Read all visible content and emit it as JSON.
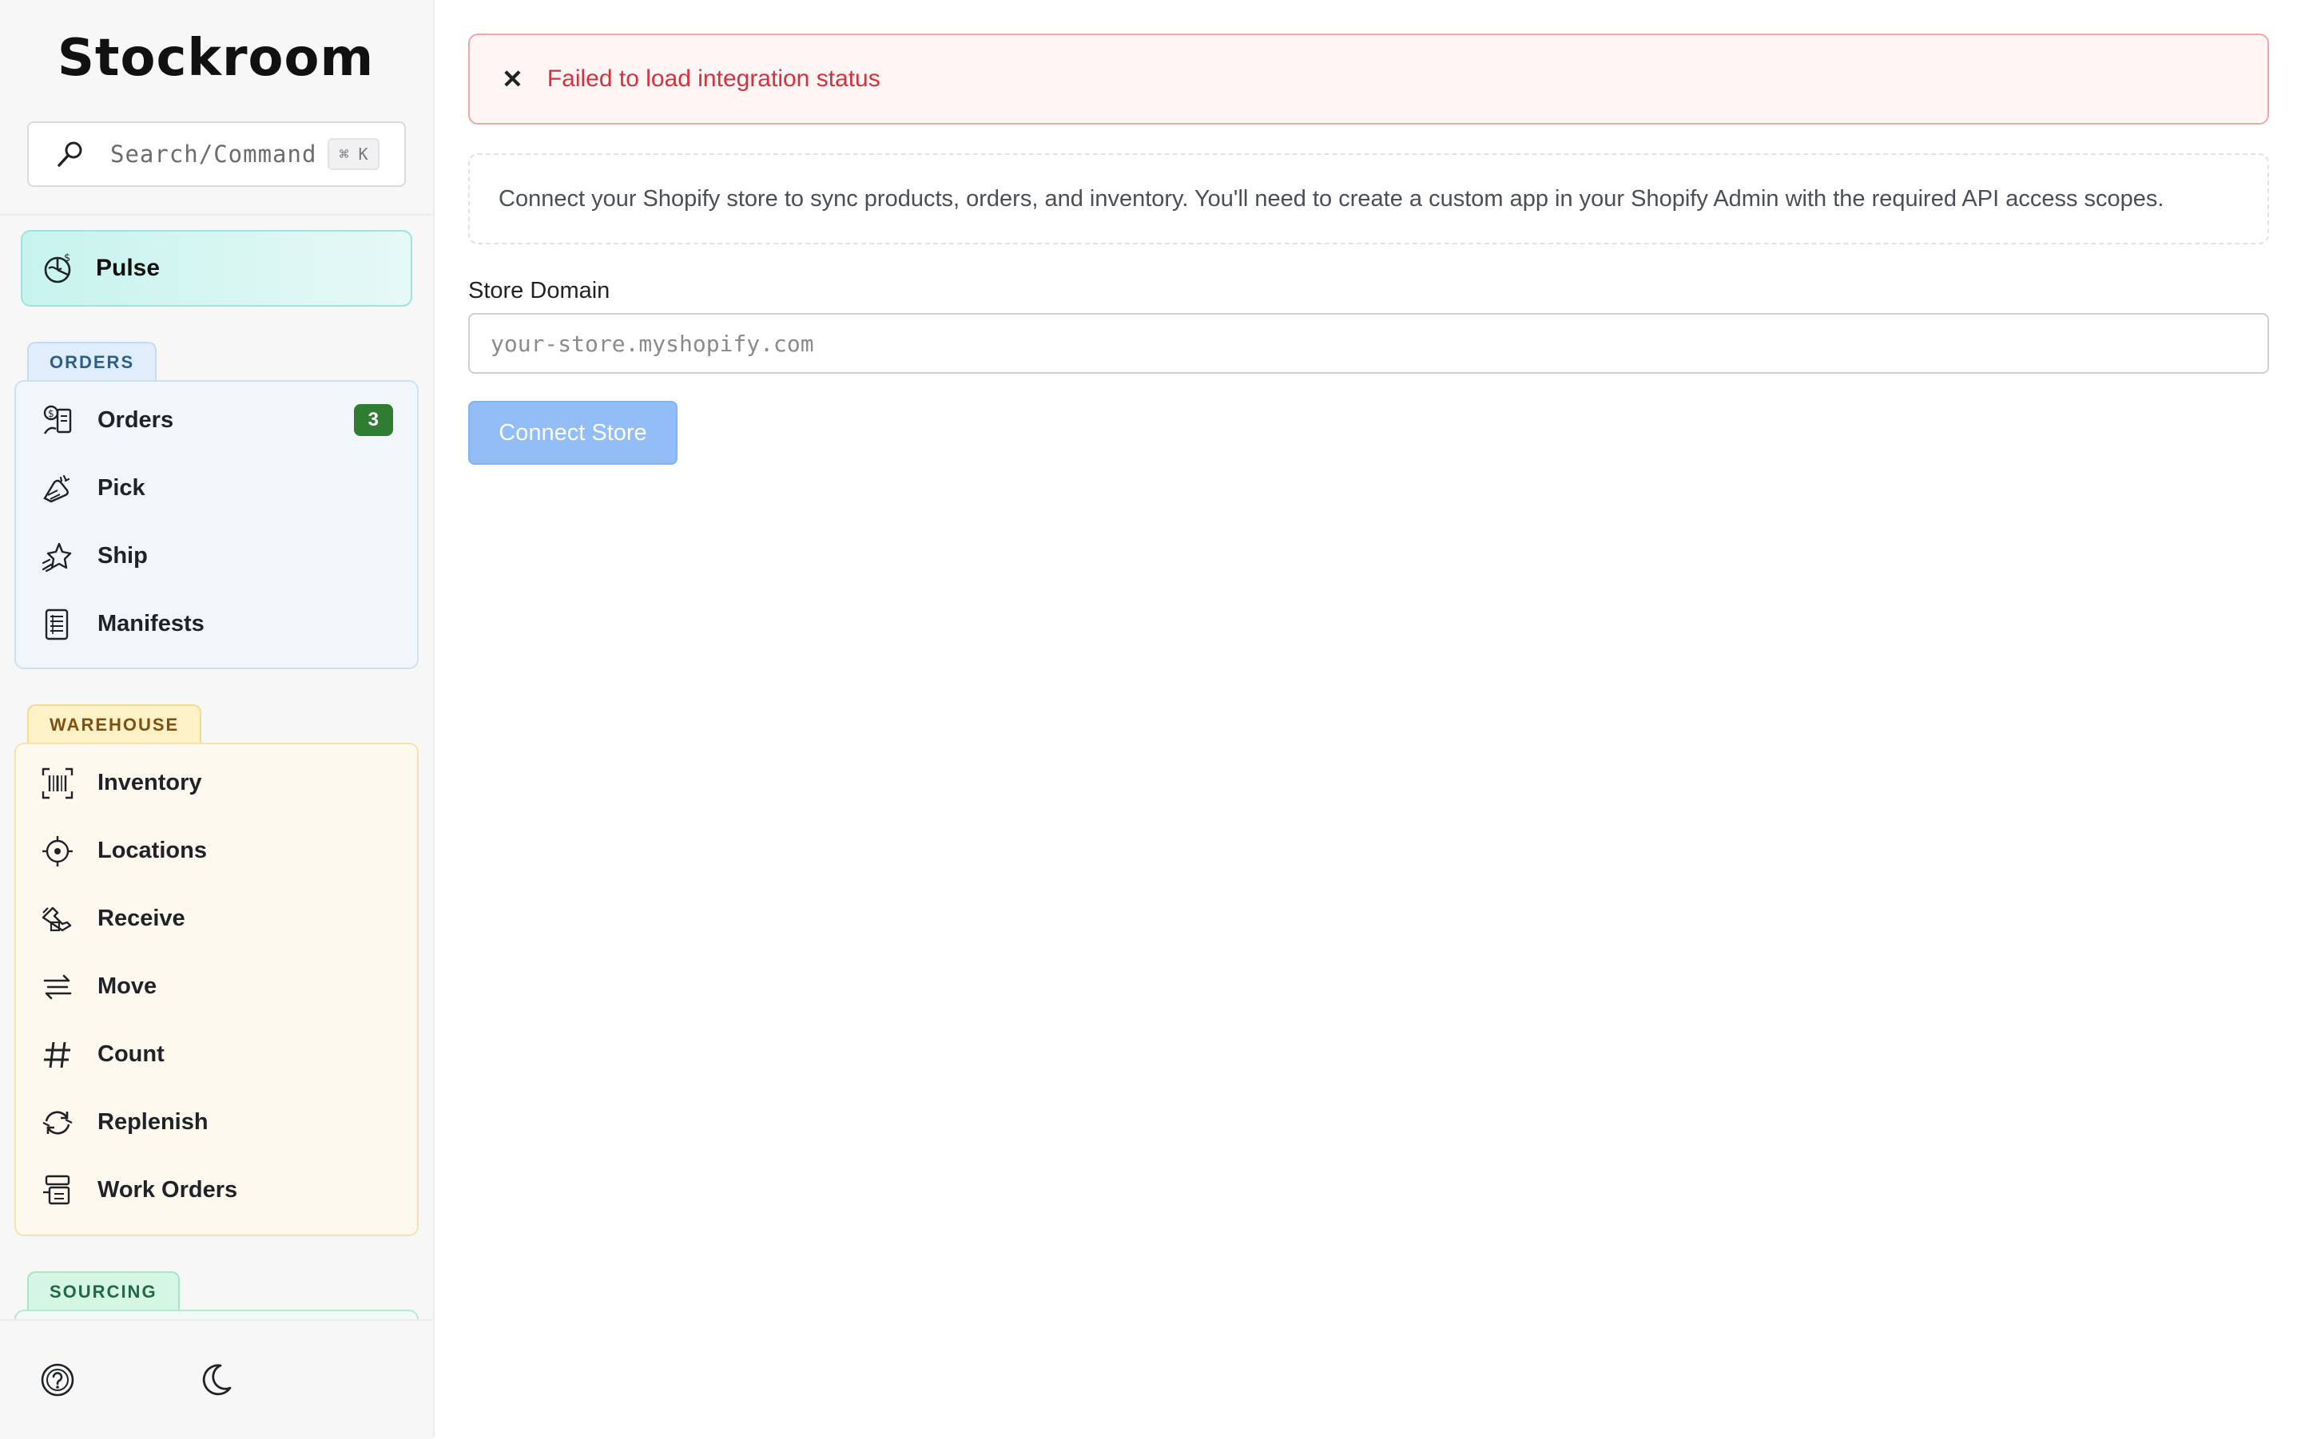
{
  "app": {
    "name": "Stockroom"
  },
  "search": {
    "placeholder": "Search/Command",
    "shortcut": "⌘ K"
  },
  "nav": {
    "pulse": {
      "label": "Pulse",
      "icon": "pulse-chart-icon"
    },
    "sections": [
      {
        "tag": "ORDERS",
        "items": [
          {
            "label": "Orders",
            "icon": "orders-icon",
            "badge": "3"
          },
          {
            "label": "Pick",
            "icon": "pick-icon"
          },
          {
            "label": "Ship",
            "icon": "ship-icon"
          },
          {
            "label": "Manifests",
            "icon": "manifest-icon"
          }
        ]
      },
      {
        "tag": "WAREHOUSE",
        "items": [
          {
            "label": "Inventory",
            "icon": "barcode-icon"
          },
          {
            "label": "Locations",
            "icon": "location-target-icon"
          },
          {
            "label": "Receive",
            "icon": "receive-icon"
          },
          {
            "label": "Move",
            "icon": "move-arrows-icon"
          },
          {
            "label": "Count",
            "icon": "hash-icon"
          },
          {
            "label": "Replenish",
            "icon": "replenish-icon"
          },
          {
            "label": "Work Orders",
            "icon": "work-orders-icon"
          }
        ]
      },
      {
        "tag": "SOURCING",
        "items": []
      }
    ]
  },
  "footer": {
    "help_icon": "help-icon",
    "theme_icon": "moon-icon"
  },
  "main": {
    "alert": {
      "message": "Failed to load integration status",
      "icon": "close-icon"
    },
    "info": "Connect your Shopify store to sync products, orders, and inventory. You'll need to create a custom app in your Shopify Admin with the required API access scopes.",
    "store_domain": {
      "label": "Store Domain",
      "placeholder": "your-store.myshopify.com",
      "value": ""
    },
    "connect_button": "Connect Store"
  },
  "colors": {
    "pulse_bg": "#c7f3ee",
    "orders_accent": "#e0eefb",
    "warehouse_accent": "#fdf1c8",
    "sourcing_accent": "#d6f6e5",
    "badge": "#2e7d32",
    "error": "#d6303b",
    "primary_disabled": "#93bdf6"
  }
}
